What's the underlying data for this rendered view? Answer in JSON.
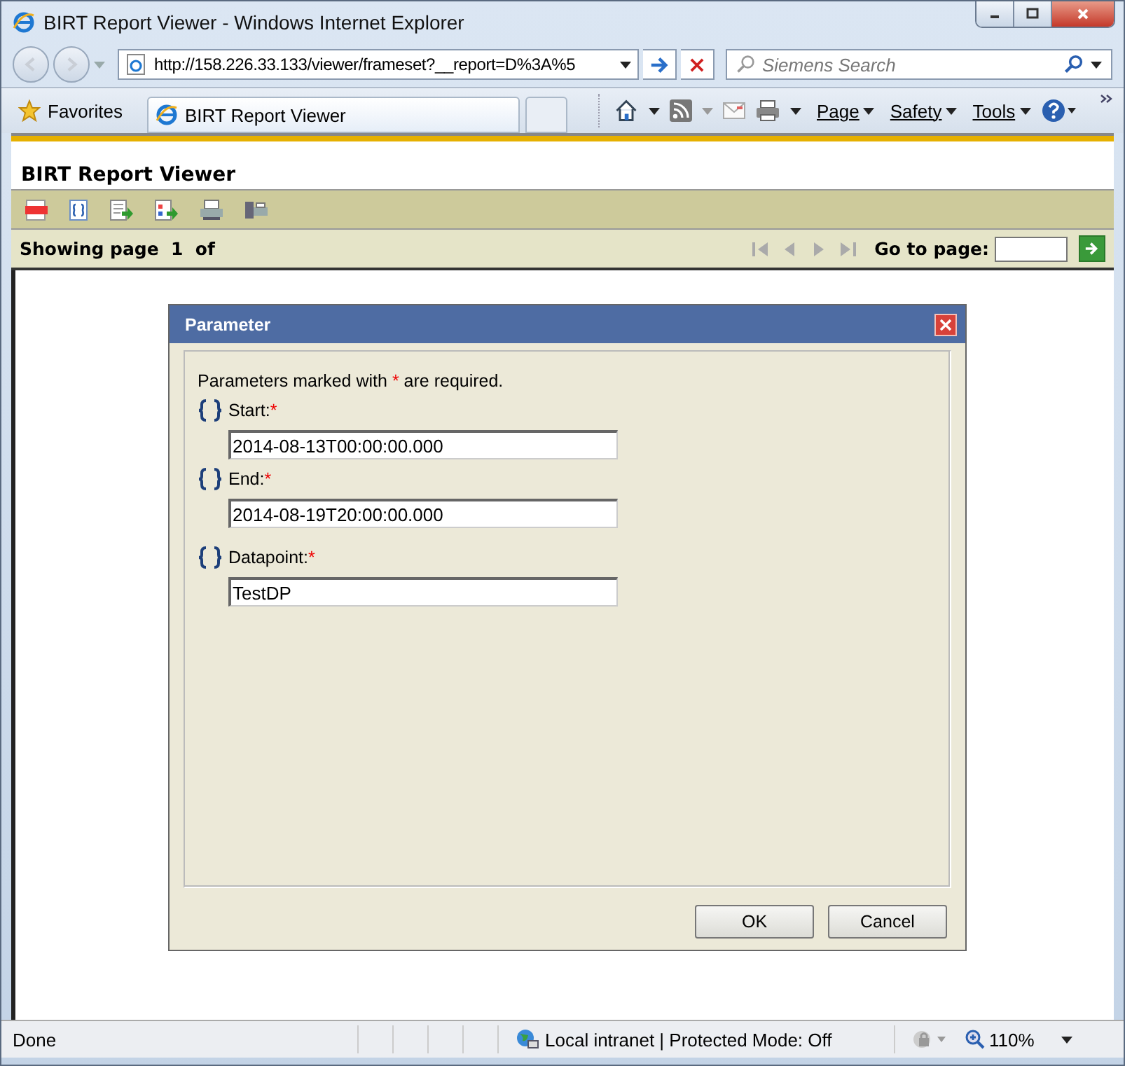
{
  "window": {
    "title": "BIRT Report Viewer - Windows Internet Explorer"
  },
  "address_bar": {
    "url": "http://158.226.33.133/viewer/frameset?__report=D%3A%5"
  },
  "search": {
    "placeholder": "Siemens Search"
  },
  "favorites": {
    "label": "Favorites"
  },
  "tabs": [
    {
      "label": "BIRT Report Viewer",
      "selected": true
    }
  ],
  "command_bar": [
    "Page",
    "Safety",
    "Tools"
  ],
  "report": {
    "title": "BIRT Report Viewer",
    "status": "Showing page  1  of",
    "goto_label": "Go to page:"
  },
  "dialog": {
    "title": "Parameter",
    "note_before": "Parameters marked with",
    "required_mark": "*",
    "note_after": "are required.",
    "parameters": [
      {
        "label": "Start:",
        "required": true,
        "value": "2014-08-13T00:00:00.000"
      },
      {
        "label": "End:",
        "required": true,
        "value": "2014-08-19T20:00:00.000"
      },
      {
        "label": "Datapoint:",
        "required": true,
        "value": "TestDP"
      }
    ],
    "buttons": [
      "OK",
      "Cancel"
    ]
  },
  "status_bar": {
    "text": "Done",
    "zone": "Local intranet | Protected Mode: Off",
    "zoom": "110%"
  }
}
